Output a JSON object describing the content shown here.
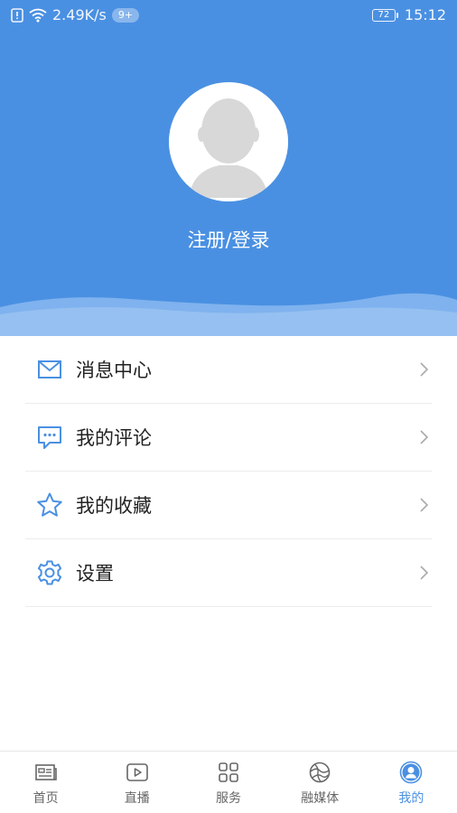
{
  "status_bar": {
    "speed": "2.49K/s",
    "notif_badge": "9+",
    "battery": "72",
    "time": "15:12"
  },
  "profile": {
    "login_label": "注册/登录"
  },
  "menu": {
    "items": [
      {
        "label": "消息中心",
        "icon": "mail-icon"
      },
      {
        "label": "我的评论",
        "icon": "comment-icon"
      },
      {
        "label": "我的收藏",
        "icon": "star-icon"
      },
      {
        "label": "设置",
        "icon": "gear-icon"
      }
    ]
  },
  "bottom_nav": {
    "items": [
      {
        "label": "首页",
        "icon": "newspaper-icon",
        "active": false
      },
      {
        "label": "直播",
        "icon": "play-icon",
        "active": false
      },
      {
        "label": "服务",
        "icon": "grid-icon",
        "active": false
      },
      {
        "label": "融媒体",
        "icon": "globe-icon",
        "active": false
      },
      {
        "label": "我的",
        "icon": "user-icon",
        "active": true
      }
    ]
  },
  "colors": {
    "primary": "#4a90e2",
    "icon": "#4a90e2",
    "text": "#222222",
    "nav_inactive": "#666666"
  }
}
